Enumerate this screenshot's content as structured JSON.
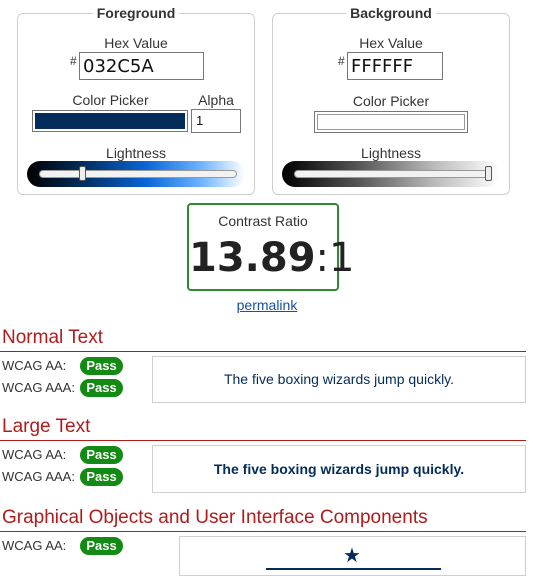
{
  "foreground": {
    "title": "Foreground",
    "hex_label": "Hex Value",
    "hash": "#",
    "hex_value": "032C5A",
    "picker_label": "Color Picker",
    "alpha_label": "Alpha",
    "alpha_value": "1",
    "lightness_label": "Lightness",
    "lightness_level": 0.21,
    "color": "#032C5A"
  },
  "background": {
    "title": "Background",
    "hex_label": "Hex Value",
    "hash": "#",
    "hex_value": "FFFFFF",
    "picker_label": "Color Picker",
    "lightness_label": "Lightness",
    "lightness_level": 1.0,
    "color": "#FFFFFF"
  },
  "contrast": {
    "title": "Contrast Ratio",
    "ratio_main": "13.89",
    "ratio_sep": ":",
    "ratio_tail": "1",
    "border_color": "#2e8b2e"
  },
  "permalink": "permalink",
  "sections": {
    "normal": {
      "heading": "Normal Text",
      "aa_label": "WCAG AA:",
      "aa_result": "Pass",
      "aaa_label": "WCAG AAA:",
      "aaa_result": "Pass",
      "sample": "The five boxing wizards jump quickly."
    },
    "large": {
      "heading": "Large Text",
      "aa_label": "WCAG AA:",
      "aa_result": "Pass",
      "aaa_label": "WCAG AAA:",
      "aaa_result": "Pass",
      "sample": "The five boxing wizards jump quickly."
    },
    "graphical": {
      "heading": "Graphical Objects and User Interface Components",
      "aa_label": "WCAG AA:",
      "aa_result": "Pass",
      "icon": "star-icon"
    }
  },
  "colors": {
    "pass": "#138a13",
    "heading": "#b01c1c"
  }
}
